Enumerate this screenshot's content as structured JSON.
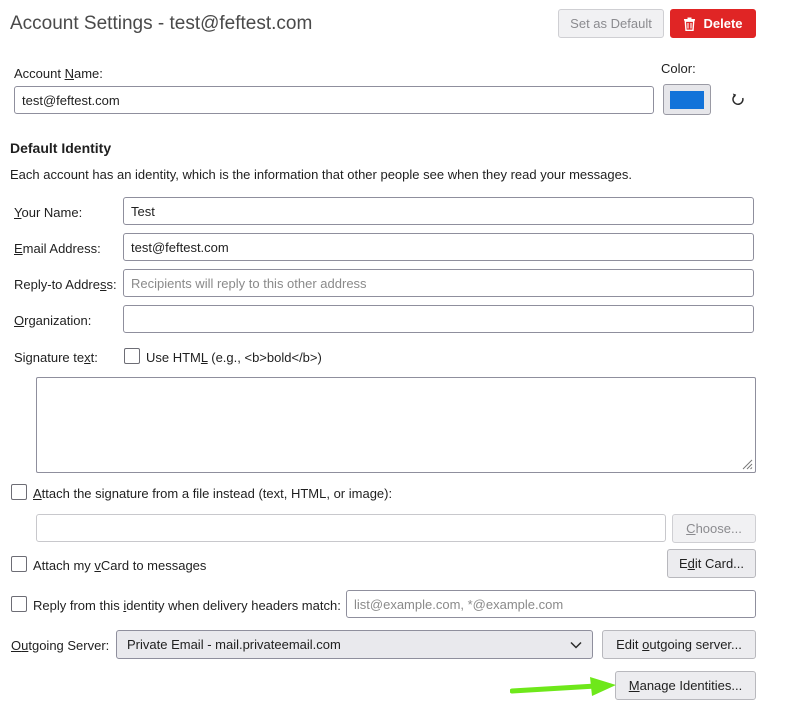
{
  "header": {
    "title": "Account Settings - test@feftest.com",
    "set_default_label": "Set as Default",
    "delete_label": "Delete"
  },
  "account": {
    "name_label_pre": "Account ",
    "name_label_key": "N",
    "name_label_post": "ame:",
    "name_value": "test@feftest.com",
    "color_label": "Color:",
    "color_value": "#1373d9"
  },
  "identity": {
    "section_title": "Default Identity",
    "description": "Each account has an identity, which is the information that other people see when they read your messages.",
    "your_name_label_key": "Y",
    "your_name_label_post": "our Name:",
    "your_name_value": "Test",
    "email_label_key": "E",
    "email_label_post": "mail Address:",
    "email_value": "test@feftest.com",
    "reply_to_label_pre": "Reply-to Addre",
    "reply_to_label_key": "s",
    "reply_to_label_post": "s:",
    "reply_to_placeholder": "Recipients will reply to this other address",
    "org_label_key": "O",
    "org_label_post": "rganization:",
    "org_value": "",
    "signature_label_pre": "Signature te",
    "signature_label_key": "x",
    "signature_label_post": "t:",
    "use_html_pre": "Use HTM",
    "use_html_key": "L",
    "use_html_post": " (e.g., <b>bold</b>)",
    "signature_text": ""
  },
  "attachments": {
    "attach_sig_pre": "",
    "attach_sig_key": "A",
    "attach_sig_post": "ttach the signature from a file instead (text, HTML, or image):",
    "sig_file_value": "",
    "choose_pre": "",
    "choose_key": "C",
    "choose_post": "hoose...",
    "vcard_pre": "Attach my ",
    "vcard_key": "v",
    "vcard_post": "Card to messages",
    "edit_card_pre": "E",
    "edit_card_key": "d",
    "edit_card_post": "it Card...",
    "reply_from_pre": "Reply from this ",
    "reply_from_key": "i",
    "reply_from_post": "dentity when delivery headers match:",
    "reply_from_placeholder": "list@example.com, *@example.com"
  },
  "outgoing": {
    "label_pre": "O",
    "label_key": "u",
    "label_post": "tgoing Server:",
    "selected": "Private Email - mail.privateemail.com",
    "edit_pre": "Edit ",
    "edit_key": "o",
    "edit_post": "utgoing server..."
  },
  "manage": {
    "pre": "",
    "key": "M",
    "post": "anage Identities..."
  },
  "colors": {
    "delete_bg": "#e02525",
    "arrow": "#6ee81a"
  }
}
